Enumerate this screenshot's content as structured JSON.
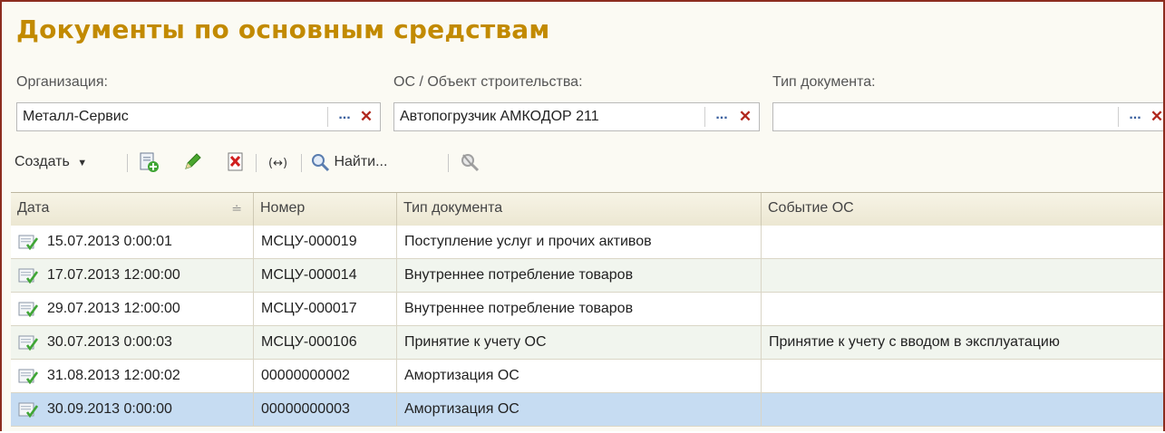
{
  "title": "Документы по основным средствам",
  "filters": {
    "org_label": "Организация:",
    "org_value": "Металл-Сервис",
    "os_label": "ОС / Объект строительства:",
    "os_value": "Автопогрузчик АМКОДОР 211",
    "doctype_label": "Тип документа:",
    "doctype_value": "",
    "select_glyph": "...",
    "clear_glyph": "✕"
  },
  "toolbar": {
    "create_label": "Создать",
    "find_label": "Найти..."
  },
  "columns": [
    "Дата",
    "Номер",
    "Тип документа",
    "Событие ОС"
  ],
  "rows": [
    {
      "date": "15.07.2013 0:00:01",
      "number": "МСЦУ-000019",
      "type": "Поступление услуг и прочих активов",
      "event": ""
    },
    {
      "date": "17.07.2013 12:00:00",
      "number": "МСЦУ-000014",
      "type": "Внутреннее потребление товаров",
      "event": ""
    },
    {
      "date": "29.07.2013 12:00:00",
      "number": "МСЦУ-000017",
      "type": "Внутреннее потребление товаров",
      "event": ""
    },
    {
      "date": "30.07.2013 0:00:03",
      "number": "МСЦУ-000106",
      "type": "Принятие к учету ОС",
      "event": "Принятие к учету с вводом в эксплуатацию"
    },
    {
      "date": "31.08.2013 12:00:02",
      "number": "00000000002",
      "type": "Амортизация ОС",
      "event": ""
    },
    {
      "date": "30.09.2013 0:00:00",
      "number": "00000000003",
      "type": "Амортизация ОС",
      "event": ""
    }
  ],
  "selected_row_index": 5
}
